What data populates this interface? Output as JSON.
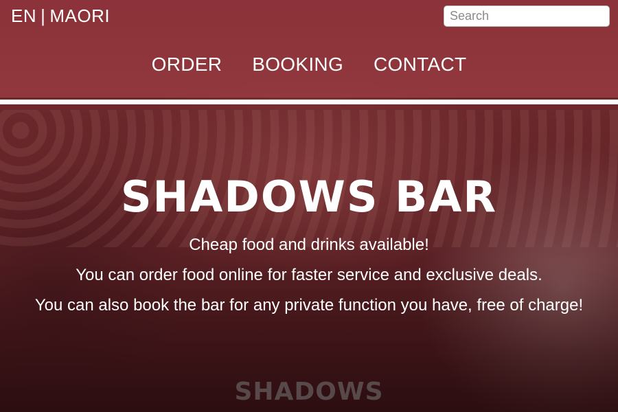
{
  "language_switch": {
    "en": "EN",
    "separator": "|",
    "maori": "MAORI"
  },
  "search": {
    "placeholder": "Search",
    "value": ""
  },
  "nav": {
    "items": [
      "ORDER",
      "BOOKING",
      "CONTACT"
    ]
  },
  "hero": {
    "title": "SHADOWS BAR",
    "line1": "Cheap food and drinks available!",
    "line2": "You can order food online for faster service and exclusive deals.",
    "line3": "You can also book the bar for any private function you have, free of charge!"
  },
  "background_logo": "SHADOWS",
  "colors": {
    "header_overlay": "#8c323a",
    "text": "#ffffff",
    "divider": "#ffffff"
  }
}
